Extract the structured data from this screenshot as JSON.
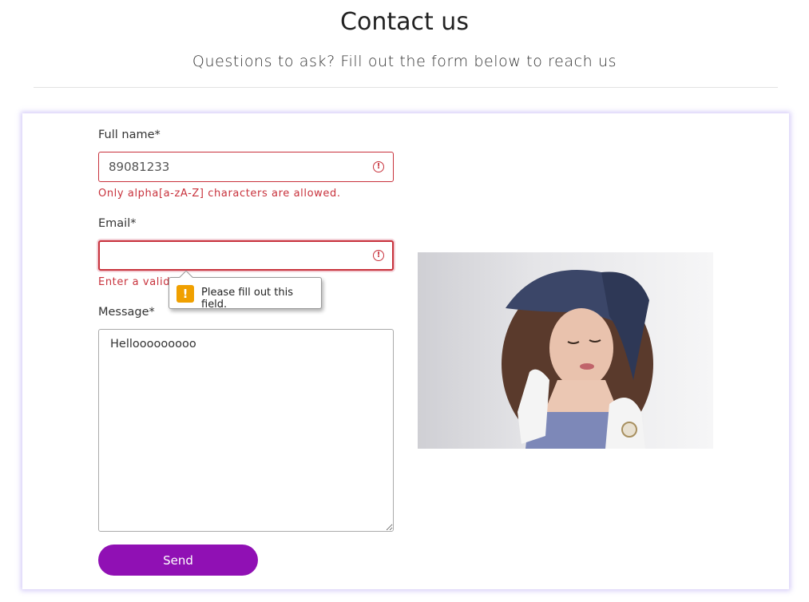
{
  "header": {
    "title": "Contact us",
    "subtitle": "Questions to ask? Fill out the form below to reach us"
  },
  "form": {
    "full_name": {
      "label": "Full name*",
      "value": "89081233",
      "error": "Only alpha[a-zA-Z] characters are allowed."
    },
    "email": {
      "label": "Email*",
      "value": "",
      "error": "Enter a valid"
    },
    "message": {
      "label": "Message*",
      "value": "Hellooooooooo"
    },
    "send_label": "Send"
  },
  "tooltip": {
    "text": "Please fill out this field.",
    "icon": "warning-icon"
  },
  "colors": {
    "accent": "#9010b4",
    "error": "#c8323c",
    "warning": "#f0a000",
    "card_glow": "#a08cf0"
  }
}
